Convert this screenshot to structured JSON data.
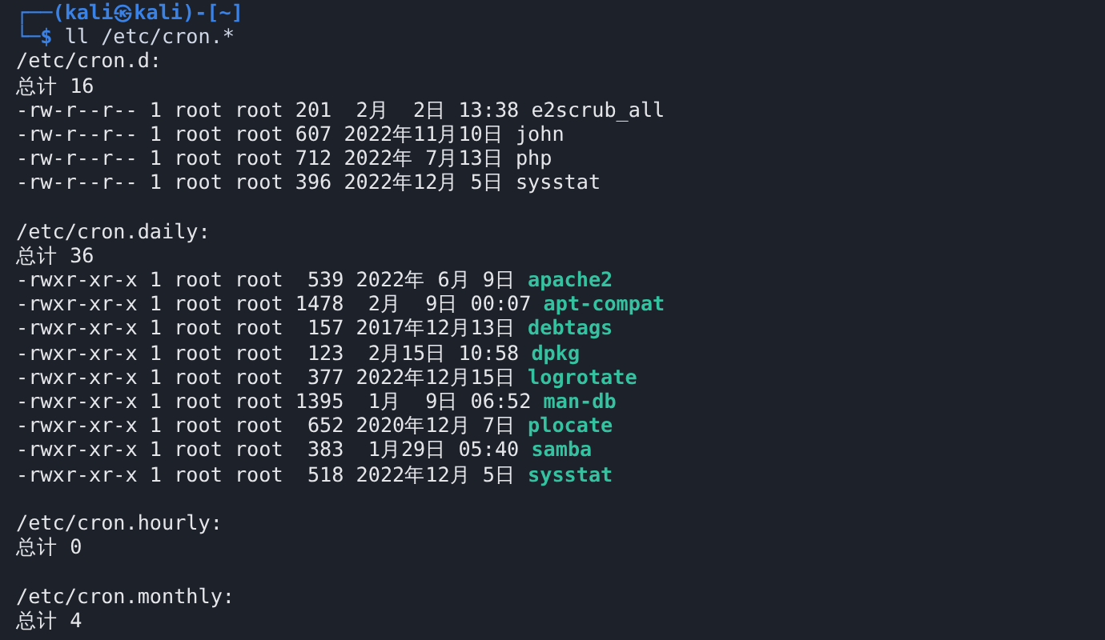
{
  "prompt": {
    "frame_top": "┌──(",
    "user_host": "kali㉿kali",
    "cwd_part": ")-[~]",
    "frame_bottom": "└─",
    "symbol": "$",
    "command": "ll /etc/cron.*"
  },
  "sections": [
    {
      "path": "/etc/cron.d:",
      "total": "总计 16",
      "entries": [
        {
          "info": "-rw-r--r-- 1 root root 201  2月  2日 13:38",
          "name": "e2scrub_all",
          "executable": false
        },
        {
          "info": "-rw-r--r-- 1 root root 607 2022年11月10日",
          "name": "john",
          "executable": false
        },
        {
          "info": "-rw-r--r-- 1 root root 712 2022年 7月13日",
          "name": "php",
          "executable": false
        },
        {
          "info": "-rw-r--r-- 1 root root 396 2022年12月 5日",
          "name": "sysstat",
          "executable": false
        }
      ]
    },
    {
      "path": "/etc/cron.daily:",
      "total": "总计 36",
      "entries": [
        {
          "info": "-rwxr-xr-x 1 root root  539 2022年 6月 9日",
          "name": "apache2",
          "executable": true
        },
        {
          "info": "-rwxr-xr-x 1 root root 1478  2月  9日 00:07",
          "name": "apt-compat",
          "executable": true
        },
        {
          "info": "-rwxr-xr-x 1 root root  157 2017年12月13日",
          "name": "debtags",
          "executable": true
        },
        {
          "info": "-rwxr-xr-x 1 root root  123  2月15日 10:58",
          "name": "dpkg",
          "executable": true
        },
        {
          "info": "-rwxr-xr-x 1 root root  377 2022年12月15日",
          "name": "logrotate",
          "executable": true
        },
        {
          "info": "-rwxr-xr-x 1 root root 1395  1月  9日 06:52",
          "name": "man-db",
          "executable": true
        },
        {
          "info": "-rwxr-xr-x 1 root root  652 2020年12月 7日",
          "name": "plocate",
          "executable": true
        },
        {
          "info": "-rwxr-xr-x 1 root root  383  1月29日 05:40",
          "name": "samba",
          "executable": true
        },
        {
          "info": "-rwxr-xr-x 1 root root  518 2022年12月 5日",
          "name": "sysstat",
          "executable": true
        }
      ]
    },
    {
      "path": "/etc/cron.hourly:",
      "total": "总计 0"
    },
    {
      "path": "/etc/cron.monthly:",
      "total": "总计 4"
    }
  ]
}
